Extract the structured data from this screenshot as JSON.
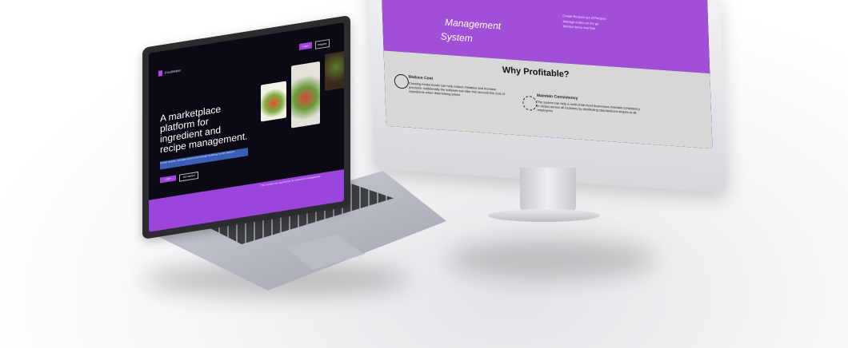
{
  "monitor": {
    "hero_title_line1": "Management",
    "hero_title_line2": "System",
    "hero_list": [
      "Create Recipes out of Recipes",
      "Manage orders on the go",
      "Monitor items overtime"
    ],
    "section_title": "Why Profitable?",
    "feature1_title": "Reduce Cost",
    "feature1_text": "Creating recipe books can help reduce mistakes and increase precision. Additionally the software can take into account the cost of ingredients when determining prices",
    "feature2_title": "Maintain Consistency",
    "feature2_text": "The system can help a multi-chain food businesses maintain consistency in dishes across all locations by distributing standardized recipes to all employees"
  },
  "laptop": {
    "brand": "FoodMaker",
    "nav_login": "Login",
    "nav_signup": "Register",
    "headline": "A marketplace platform for ingredient and recipe management.",
    "subheadline": "Create recipes, compare prices and manage inventory in one platform.",
    "cta_primary": "Login",
    "cta_secondary": "Get started",
    "strip_text": "The number one application for restaurant management"
  },
  "colors": {
    "accent_purple": "#9b45dc",
    "hero_purple": "#a24fd8",
    "section_gray": "#d7d7d7",
    "laptop_bg": "#0b0a14"
  }
}
